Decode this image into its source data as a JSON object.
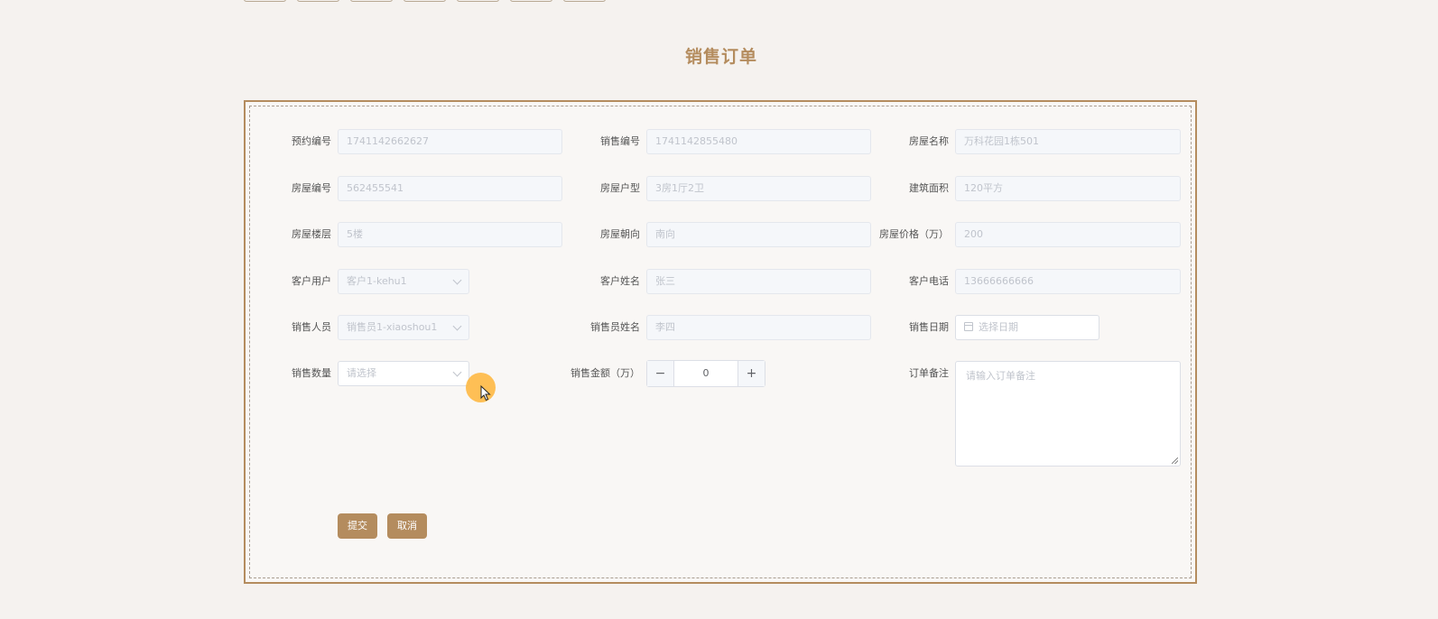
{
  "page_title": "销售订单",
  "form": {
    "fields": [
      {
        "label": "预约编号",
        "value": "1741142662627"
      },
      {
        "label": "销售编号",
        "value": "1741142855480"
      },
      {
        "label": "房屋名称",
        "value": "万科花园1栋501"
      },
      {
        "label": "房屋编号",
        "value": "562455541"
      },
      {
        "label": "房屋户型",
        "value": "3房1厅2卫"
      },
      {
        "label": "建筑面积",
        "value": "120平方"
      },
      {
        "label": "房屋楼层",
        "value": "5楼"
      },
      {
        "label": "房屋朝向",
        "value": "南向"
      },
      {
        "label": "房屋价格（万）",
        "value": "200"
      },
      {
        "label": "客户用户",
        "value": "客户1-kehu1"
      },
      {
        "label": "客户姓名",
        "value": "张三"
      },
      {
        "label": "客户电话",
        "value": "13666666666"
      },
      {
        "label": "销售人员",
        "value": "销售员1-xiaoshou1"
      },
      {
        "label": "销售员姓名",
        "value": "李四"
      },
      {
        "label": "销售日期",
        "placeholder": "选择日期"
      },
      {
        "label": "销售数量",
        "placeholder": "请选择"
      },
      {
        "label": "销售金额（万）",
        "value": "0",
        "minus": "−",
        "plus": "+"
      },
      {
        "label": "订单备注",
        "placeholder": "请输入订单备注"
      }
    ],
    "buttons": {
      "submit": "提交",
      "cancel": "取消"
    }
  },
  "colors": {
    "accent": "#b48c5e",
    "background": "#f5f2ef",
    "cursor_highlight": "#ffb028"
  }
}
